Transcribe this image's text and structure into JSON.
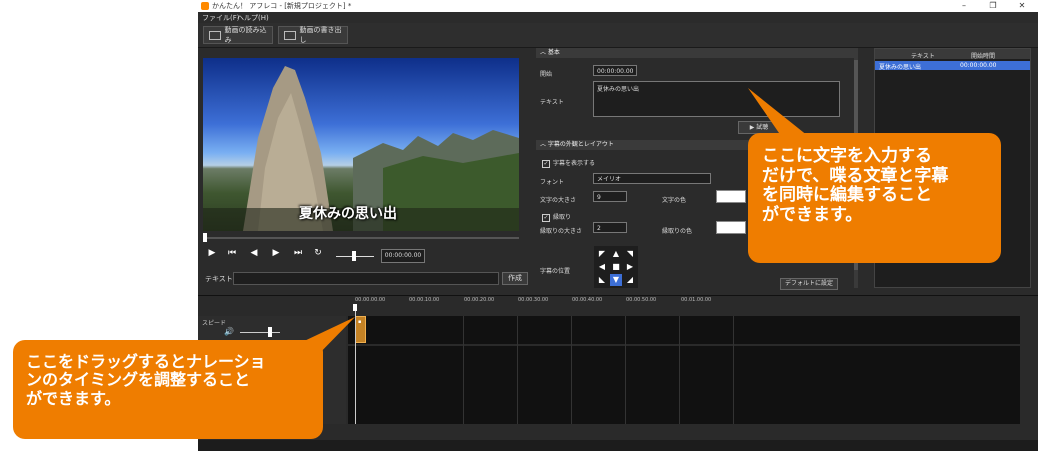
{
  "window": {
    "title": "かんたん！ アフレコ - [新規プロジェクト] *",
    "minimize": "–",
    "maximize": "❐",
    "close": "✕"
  },
  "menu": {
    "file": "ファイル(F)",
    "help": "ヘルプ(H)"
  },
  "toolbar": {
    "load_video": "動画の読み込み",
    "export_video": "動画の書き出し"
  },
  "preview": {
    "subtitle": "夏休みの思い出"
  },
  "playback": {
    "play_icon": "▶",
    "prev_icon": "⏮",
    "step_back_icon": "◀",
    "step_fwd_icon": "▶",
    "next_icon": "⏭",
    "loop_icon": "↻",
    "time": "00:00:00.00",
    "text_label": "テキスト",
    "create_label": "作成"
  },
  "props": {
    "basic_header": "基本",
    "start_label": "開始",
    "start_value": "00:00:00.00",
    "text_label": "テキスト",
    "text_value": "夏休みの思い出",
    "play_label": "▶ 試聴",
    "style_header": "字幕の外観とレイアウト",
    "show_subtitle_label": "字幕を表示する",
    "font_label": "フォント",
    "font_value": "メイリオ",
    "size_label": "文字の大きさ",
    "size_value": "9",
    "color_label": "文字の色",
    "outline_label": "縁取り",
    "outline_size_label": "縁取りの大きさ",
    "outline_size_value": "2",
    "outline_color_label": "縁取りの色",
    "position_label": "字幕の位置",
    "default_button": "デフォルトに設定",
    "checkmark": "✓"
  },
  "list": {
    "col_text": "テキスト",
    "col_start": "開始時間",
    "rows": [
      {
        "text": "夏休みの思い出",
        "start": "00:00:00.00"
      }
    ]
  },
  "timeline": {
    "ticks": [
      "00.00.00.00",
      "00.00.10.00",
      "00.00.20.00",
      "00.00.30.00",
      "00.00.40.00",
      "00.00.50.00",
      "00.01.00.00"
    ],
    "speed_label": "スピード",
    "volume_icon": "🔊"
  },
  "callouts": {
    "top": "ここに文字を入力する\nだけで、喋る文章と字幕\nを同時に編集すること\nができます。",
    "bottom": "ここをドラッグするとナレーショ\nンのタイミングを調整すること\nができます。"
  }
}
